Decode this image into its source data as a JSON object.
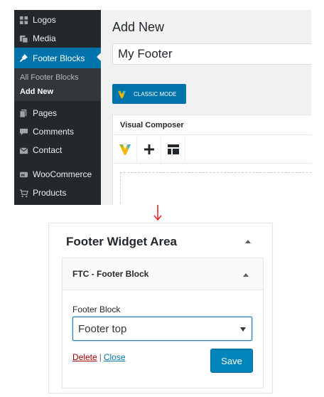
{
  "admin_menu": {
    "items": [
      {
        "label": "Logos",
        "icon": "grid-icon"
      },
      {
        "label": "Media",
        "icon": "media-icon"
      },
      {
        "label": "Footer Blocks",
        "icon": "pin-icon",
        "active": true
      },
      {
        "label": "Pages",
        "icon": "pages-icon"
      },
      {
        "label": "Comments",
        "icon": "comments-icon"
      },
      {
        "label": "Contact",
        "icon": "mail-icon"
      },
      {
        "label": "WooCommerce",
        "icon": "woocommerce-icon"
      },
      {
        "label": "Products",
        "icon": "cart-icon"
      }
    ],
    "submenu": [
      {
        "label": "All Footer Blocks"
      },
      {
        "label": "Add New",
        "current": true
      }
    ]
  },
  "editor": {
    "page_title": "Add New",
    "post_title_value": "My Footer",
    "classic_mode_label": "CLASSIC MODE",
    "visual_composer_title": "Visual Composer",
    "toolbar_icons": [
      "vc-logo-icon",
      "plus-icon",
      "layout-template-icon"
    ]
  },
  "widget_area": {
    "title": "Footer Widget Area",
    "widget": {
      "title": "FTC - Footer Block",
      "field_label": "Footer Block",
      "selected_value": "Footer top",
      "delete_label": "Delete",
      "separator": "|",
      "close_label": "Close",
      "save_label": "Save"
    }
  },
  "colors": {
    "admin_sidebar": "#23282d",
    "active_blue": "#0073aa",
    "save_blue": "#0085ba",
    "arrow_red": "#e02020",
    "delete_red": "#a00000"
  }
}
